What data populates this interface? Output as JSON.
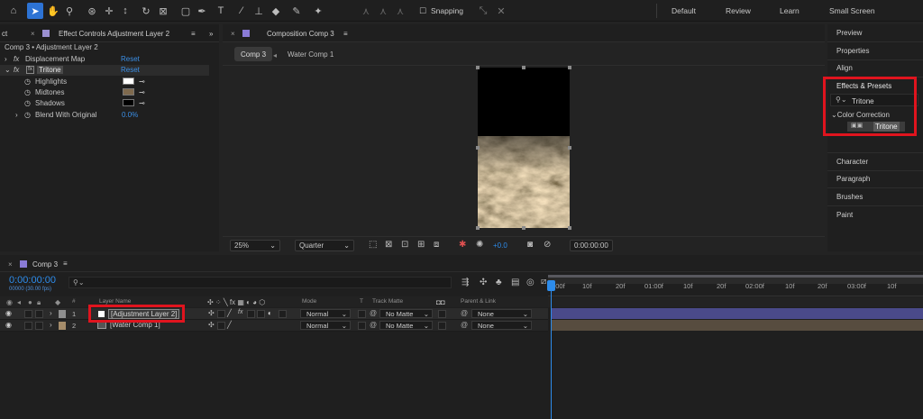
{
  "toolbar": {
    "snapping_label": "Snapping",
    "workspaces": [
      "Default",
      "Review",
      "Learn",
      "Small Screen"
    ],
    "icons": [
      "home-icon",
      "selection-arrow-icon",
      "hand-icon",
      "zoom-icon",
      "orbit-icon",
      "pan-behind-icon",
      "dolly-icon",
      "rotate-icon",
      "anchor-icon",
      "rectangle-icon",
      "pen-icon",
      "type-icon",
      "brush-icon",
      "stamp-icon",
      "eraser-icon",
      "roto-brush-icon",
      "puppet-pin-icon"
    ]
  },
  "effect_controls": {
    "left_tab_partial": "ct",
    "tab_label": "Effect Controls Adjustment Layer 2",
    "breadcrumb": "Comp 3 • Adjustment Layer 2",
    "effects": [
      {
        "name": "Displacement Map",
        "reset": "Reset"
      },
      {
        "name": "Tritone",
        "reset": "Reset"
      }
    ],
    "properties": [
      {
        "name": "Highlights",
        "color": "#ffffff"
      },
      {
        "name": "Midtones",
        "color": "#7f6a4e"
      },
      {
        "name": "Shadows",
        "color": "#000000"
      },
      {
        "name": "Blend With Original",
        "value": "0.0%"
      }
    ]
  },
  "composition": {
    "tab_label": "Composition Comp 3",
    "sub_tabs": [
      "Comp 3",
      "Water Comp 1"
    ],
    "zoom": "25%",
    "resolution": "Quarter",
    "exposure": "+0.0",
    "timecode": "0:00:00:00"
  },
  "right_panel": {
    "items_top": [
      "Preview",
      "Properties",
      "Align"
    ],
    "effects_presets": {
      "title": "Effects & Presets",
      "search_value": "Tritone",
      "category": "Color Correction",
      "result": "Tritone"
    },
    "items_bottom": [
      "Character",
      "Paragraph",
      "Brushes",
      "Paint"
    ]
  },
  "timeline": {
    "tab_label": "Comp 3",
    "timecode": "0:00:00:00",
    "fps_label": "00000 (30.00 fps)",
    "columns": {
      "num": "#",
      "layer_name": "Layer Name",
      "mode": "Mode",
      "t": "T",
      "track_matte": "Track Matte",
      "parent_link": "Parent & Link"
    },
    "layers": [
      {
        "num": "1",
        "name": "[Adjustment Layer 2]",
        "mode": "Normal",
        "matte": "No Matte",
        "parent": "None",
        "label_color": "#8f8f8f",
        "selected": true
      },
      {
        "num": "2",
        "name": "[Water Comp 1]",
        "mode": "Normal",
        "matte": "No Matte",
        "parent": "None",
        "label_color": "#a58c6a",
        "selected": false
      }
    ],
    "ruler": [
      "0:00f",
      "10f",
      "20f",
      "01:00f",
      "10f",
      "20f",
      "02:00f",
      "10f",
      "20f",
      "03:00f",
      "10f"
    ]
  }
}
